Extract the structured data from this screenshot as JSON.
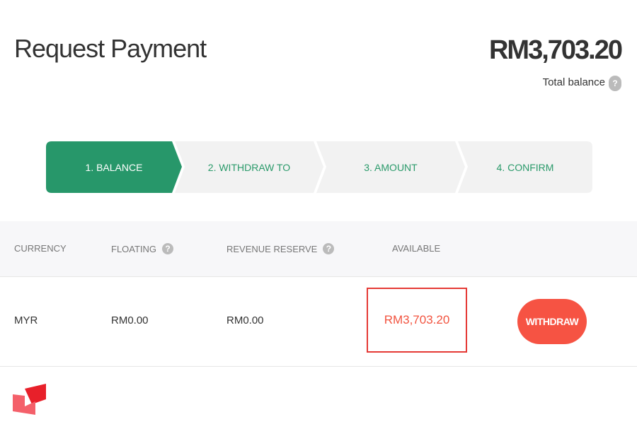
{
  "header": {
    "title": "Request Payment",
    "total_balance": "RM3,703.20",
    "total_balance_label": "Total balance",
    "help_icon": "?"
  },
  "steps": [
    {
      "label": "1. BALANCE",
      "active": true
    },
    {
      "label": "2. WITHDRAW TO",
      "active": false
    },
    {
      "label": "3. AMOUNT",
      "active": false
    },
    {
      "label": "4. CONFIRM",
      "active": false
    }
  ],
  "colors": {
    "active_step": "#27976a",
    "inactive_step": "#f2f2f2",
    "accent": "#f65343",
    "highlight_border": "#e53935"
  },
  "table": {
    "columns": [
      "CURRENCY",
      "FLOATING",
      "REVENUE RESERVE",
      "AVAILABLE"
    ],
    "rows": [
      {
        "currency": "MYR",
        "floating": "RM0.00",
        "revenue_reserve": "RM0.00",
        "available": "RM3,703.20",
        "action": "WITHDRAW"
      }
    ]
  }
}
